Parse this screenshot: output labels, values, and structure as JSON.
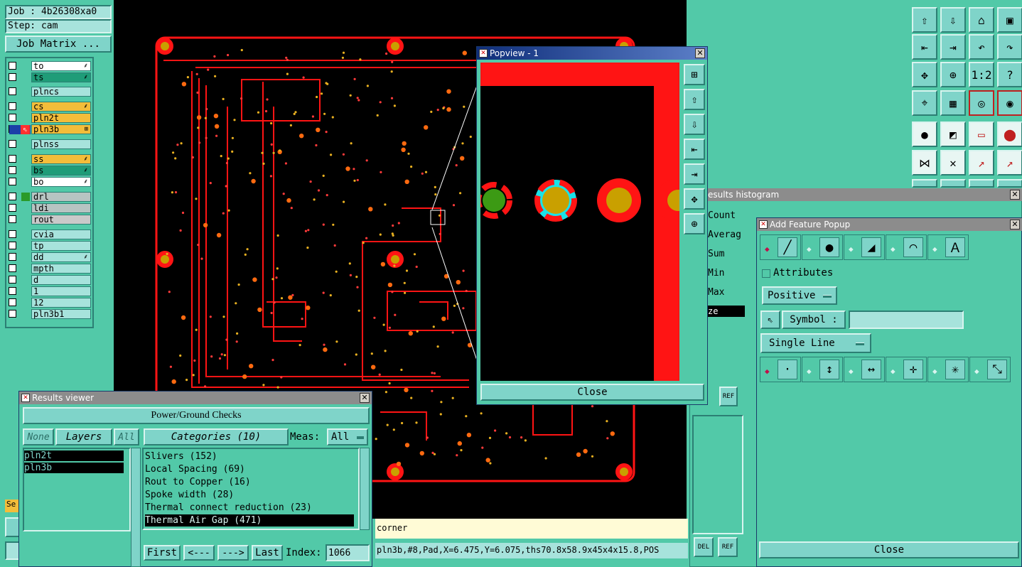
{
  "job": {
    "job_label": "Job : 4b26308xa0",
    "step_label": "Step: cam",
    "matrix_button": "Job Matrix ..."
  },
  "layers": [
    {
      "name": "to",
      "color": "#ffffff",
      "flag": "⸙"
    },
    {
      "name": "ts",
      "color": "#1f9c78",
      "flag": "⸙"
    },
    {
      "name": "plncs",
      "color": "#a7e3dc",
      "flag": ""
    },
    {
      "name": "cs",
      "color": "#f3bd3a",
      "flag": "⸙"
    },
    {
      "name": "pln2t",
      "color": "#f3bd3a",
      "flag": ""
    },
    {
      "name": "pln3b",
      "color": "#f3bd3a",
      "flag": "⊞"
    },
    {
      "name": "plnss",
      "color": "#a7e3dc",
      "flag": ""
    },
    {
      "name": "ss",
      "color": "#f3bd3a",
      "flag": "⸙"
    },
    {
      "name": "bs",
      "color": "#1f9c78",
      "flag": "⸙"
    },
    {
      "name": "bo",
      "color": "#ffffff",
      "flag": "⸙"
    },
    {
      "name": "drl",
      "color": "#b7c4c2",
      "flag": ""
    },
    {
      "name": "ldi",
      "color": "#b7c4c2",
      "flag": ""
    },
    {
      "name": "rout",
      "color": "#c9c9c9",
      "flag": ""
    },
    {
      "name": "cvia",
      "color": "#a7e3dc",
      "flag": ""
    },
    {
      "name": "tp",
      "color": "#a7e3dc",
      "flag": ""
    },
    {
      "name": "dd",
      "color": "#a7e3dc",
      "flag": "⸙"
    },
    {
      "name": "mpth",
      "color": "#a7e3dc",
      "flag": ""
    },
    {
      "name": "d",
      "color": "#a7e3dc",
      "flag": ""
    },
    {
      "name": "1",
      "color": "#a7e3dc",
      "flag": ""
    },
    {
      "name": "12",
      "color": "#a7e3dc",
      "flag": ""
    },
    {
      "name": "pln3b1",
      "color": "#a7e3dc",
      "flag": ""
    }
  ],
  "popview": {
    "title": "Popview - 1",
    "close_label": "Close"
  },
  "histogram": {
    "title": "esults histogram",
    "stats": [
      "Count",
      "Averag",
      "Sum",
      "Min",
      "Max"
    ],
    "ze_label": "ze",
    "del_label": "DEL",
    "ref_label": "REF"
  },
  "add_feature": {
    "title": "Add Feature Popup",
    "attributes_label": "Attributes",
    "polarity": "Positive",
    "symbol_label": "Symbol :",
    "symbol_value": "",
    "line_mode": "Single Line",
    "close_label": "Close"
  },
  "results_viewer": {
    "title": "Results viewer",
    "check_name": "Power/Ground Checks",
    "none_label": "None",
    "layers_label": "Layers",
    "all_label": "All",
    "categories_label": "Categories (10)",
    "meas_label": "Meas:",
    "meas_value": "All",
    "layer_items": [
      "pln2t",
      "pln3b"
    ],
    "categories": [
      "Slivers (152)",
      "Local Spacing (69)",
      "Rout to Copper (16)",
      "Spoke width (28)",
      "Thermal connect reduction (23)",
      "Thermal Air Gap (471)"
    ],
    "first_label": "First",
    "prev_label": "<---",
    "next_label": "--->",
    "last_label": "Last",
    "index_label": "Index:",
    "index_value": "1066"
  },
  "status": {
    "corner_text": "corner",
    "feature_info": "pln3b,#8,Pad,X=6.475,Y=6.075,ths70.8x58.9x45x4x15.8,POS"
  },
  "misc": {
    "left_partial_label": "Se"
  },
  "colors": {
    "board_bg": "#000000",
    "copper": "#ff1414",
    "pad_fill": "#c9a000",
    "dot": "#e8b020",
    "teal": "#52c9a8",
    "light_teal": "#a7e3dc"
  }
}
